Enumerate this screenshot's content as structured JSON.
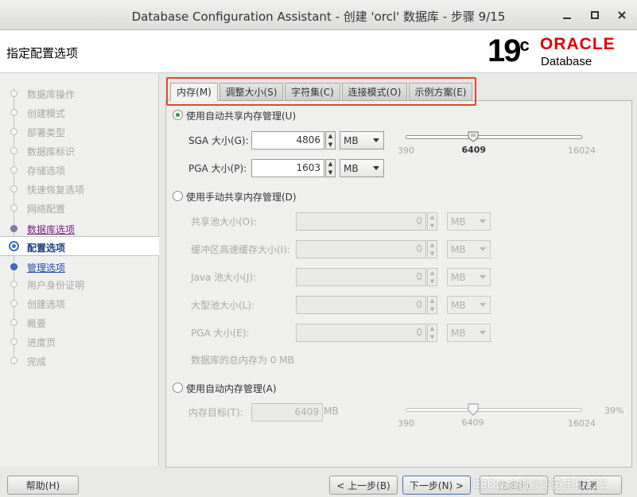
{
  "window": {
    "title": "Database Configuration Assistant - 创建 'orcl' 数据库 - 步骤 9/15"
  },
  "header": {
    "heading": "指定配置选项",
    "logo_version": "19",
    "logo_version_suffix": "c",
    "logo_brand": "ORACLE",
    "logo_product": "Database"
  },
  "sidebar": {
    "steps": [
      {
        "label": "数据库操作"
      },
      {
        "label": "创建模式"
      },
      {
        "label": "部署类型"
      },
      {
        "label": "数据库标识"
      },
      {
        "label": "存储选项"
      },
      {
        "label": "快速恢复选项"
      },
      {
        "label": "网络配置"
      },
      {
        "label": "数据库选项"
      },
      {
        "label": "配置选项"
      },
      {
        "label": "管理选项"
      },
      {
        "label": "用户身份证明"
      },
      {
        "label": "创建选项"
      },
      {
        "label": "概要"
      },
      {
        "label": "进度页"
      },
      {
        "label": "完成"
      }
    ]
  },
  "tabs": [
    {
      "label": "内存(M)"
    },
    {
      "label": "调整大小(S)"
    },
    {
      "label": "字符集(C)"
    },
    {
      "label": "连接模式(O)"
    },
    {
      "label": "示例方案(E)"
    }
  ],
  "memory": {
    "auto_shared": {
      "label": "使用自动共享内存管理(U)",
      "sga_label": "SGA 大小(G):",
      "sga_value": "4806",
      "sga_unit": "MB",
      "pga_label": "PGA 大小(P):",
      "pga_value": "1603",
      "pga_unit": "MB",
      "slider": {
        "min": "390",
        "max": "16024",
        "value": "6409",
        "min_num": 390,
        "max_num": 16024,
        "value_num": 6409
      }
    },
    "manual_shared": {
      "label": "使用手动共享内存管理(D)",
      "fields": [
        {
          "label": "共享池大小(O):",
          "value": "0",
          "unit": "MB"
        },
        {
          "label": "缓冲区高速缓存大小(I):",
          "value": "0",
          "unit": "MB"
        },
        {
          "label": "Java 池大小(J):",
          "value": "0",
          "unit": "MB"
        },
        {
          "label": "大型池大小(L):",
          "value": "0",
          "unit": "MB"
        },
        {
          "label": "PGA 大小(E):",
          "value": "0",
          "unit": "MB"
        }
      ],
      "total": "数据库的总内存为 0 MB"
    },
    "auto_memory": {
      "label": "使用自动内存管理(A)",
      "target_label": "内存目标(T):",
      "target_value": "6409",
      "target_unit": "MB",
      "slider": {
        "min": "390",
        "max": "16024",
        "value": "6409",
        "percent": "39%",
        "min_num": 390,
        "max_num": 16024,
        "value_num": 6409
      }
    }
  },
  "buttons": {
    "help": "帮助(H)",
    "back": "< 上一步(B)",
    "next": "下一步(N) >",
    "finish": "完成(F)",
    "cancel": "取消"
  },
  "watermark": "CSDN @流沙跟苏丰扣122",
  "colors": {
    "accent": "#3b6fc4",
    "tab_highlight": "#e04a2a",
    "oracle_red": "#e00000",
    "radio_on": "#3f8f4a"
  }
}
